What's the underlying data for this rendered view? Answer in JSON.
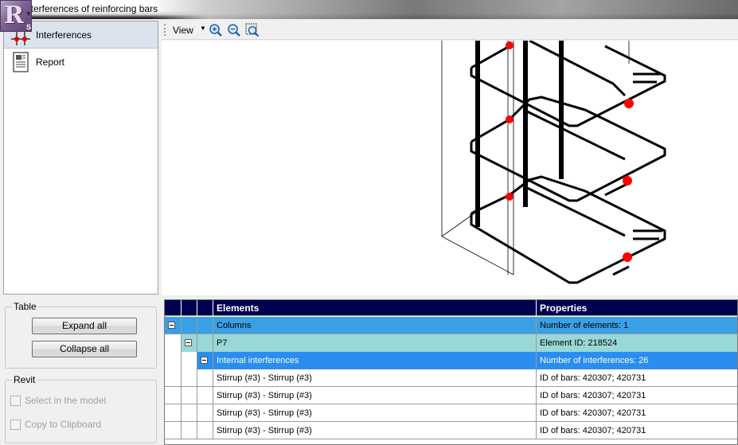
{
  "window": {
    "title": "nterferences of reinforcing bars",
    "app_badge": "R",
    "app_badge_sub": "S"
  },
  "nav": {
    "items": [
      {
        "label": "Interferences",
        "icon": "interferences-icon",
        "selected": true
      },
      {
        "label": "Report",
        "icon": "report-icon",
        "selected": false
      }
    ]
  },
  "table_group": {
    "title": "Table",
    "expand_label": "Expand all",
    "collapse_label": "Collapse all"
  },
  "revit_group": {
    "title": "Revit",
    "select_label": "Select in the model",
    "copy_label": "Copy to Clipboard"
  },
  "toolbar": {
    "view_label": "View",
    "icons": [
      "zoom-in-icon",
      "zoom-out-icon",
      "zoom-fit-icon"
    ]
  },
  "grid": {
    "columns": [
      "Elements",
      "Properties"
    ],
    "rows": [
      {
        "level": 0,
        "element": "Columns",
        "property": "Number of elements: 1"
      },
      {
        "level": 1,
        "element": "P7",
        "property": "Element ID: 218524"
      },
      {
        "level": 2,
        "element": "Internal interferences",
        "property": "Number of interferences: 26"
      },
      {
        "level": 3,
        "element": "Stirrup (#3) - Stirrup (#3)",
        "property": "ID of bars: 420307; 420731"
      },
      {
        "level": 3,
        "element": "Stirrup (#3) - Stirrup (#3)",
        "property": "ID of bars: 420307; 420731"
      },
      {
        "level": 3,
        "element": "Stirrup (#3) - Stirrup (#3)",
        "property": "ID of bars: 420307; 420731"
      },
      {
        "level": 3,
        "element": "Stirrup (#3) - Stirrup (#3)",
        "property": "ID of bars: 420307; 420731"
      }
    ]
  },
  "colors": {
    "header": "#000050",
    "columns_row": "#3aa0e6",
    "p7_row": "#99d8d6",
    "internal_row": "#2a8ef0",
    "interference_point": "#ff0000"
  }
}
